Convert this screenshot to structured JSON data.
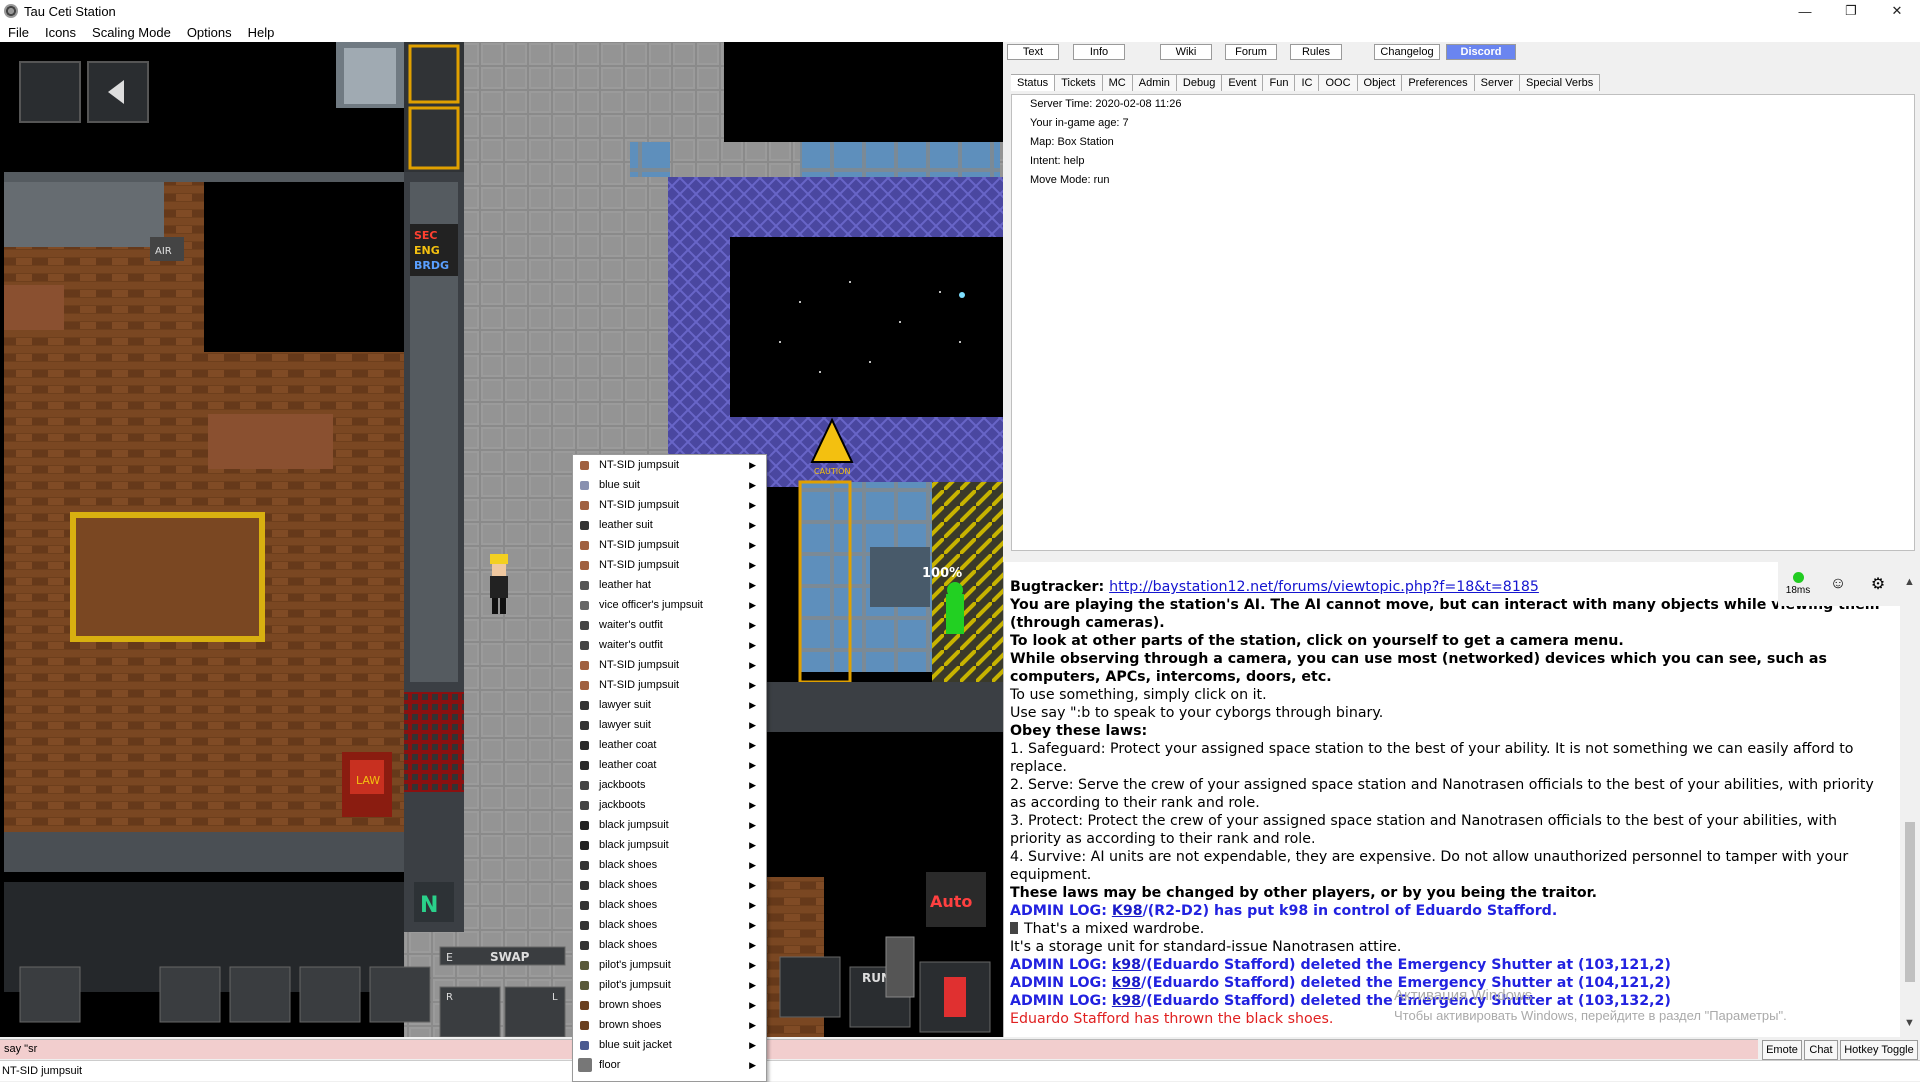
{
  "window": {
    "title": "Tau Ceti Station",
    "controls": [
      "—",
      "❐",
      "✕"
    ]
  },
  "menu": [
    "File",
    "Icons",
    "Scaling Mode",
    "Options",
    "Help"
  ],
  "links": [
    {
      "label": "Text"
    },
    {
      "label": "Info"
    },
    {
      "label": "Wiki"
    },
    {
      "label": "Forum"
    },
    {
      "label": "Rules"
    },
    {
      "label": "Changelog"
    },
    {
      "label": "Discord"
    }
  ],
  "tabs": [
    "Status",
    "Tickets",
    "MC",
    "Admin",
    "Debug",
    "Event",
    "Fun",
    "IC",
    "OOC",
    "Object",
    "Preferences",
    "Server",
    "Special Verbs"
  ],
  "status": [
    "Server Time: 2020-02-08 11:26",
    "Your in-game age: 7",
    "Map: Box Station",
    "Intent: help",
    "Move Mode: run"
  ],
  "hud": {
    "swap": "SWAP",
    "run": "RUN",
    "sec": "SEC",
    "eng": "ENG",
    "brdg": "BRDG",
    "air": "AIR",
    "percent": "100%",
    "auto": "Auto",
    "caution": "CAUTION",
    "e": "E",
    "r": "R",
    "l": "L",
    "n": "N",
    "law": "LAW"
  },
  "context_menu": [
    "NT-SID jumpsuit",
    "blue suit",
    "NT-SID jumpsuit",
    "leather suit",
    "NT-SID jumpsuit",
    "NT-SID jumpsuit",
    "leather hat",
    "vice officer's jumpsuit",
    "waiter's outfit",
    "waiter's outfit",
    "NT-SID jumpsuit",
    "NT-SID jumpsuit",
    "lawyer suit",
    "lawyer suit",
    "leather coat",
    "leather coat",
    "jackboots",
    "jackboots",
    "black jumpsuit",
    "black jumpsuit",
    "black shoes",
    "black shoes",
    "black shoes",
    "black shoes",
    "black shoes",
    "pilot's jumpsuit",
    "pilot's jumpsuit",
    "brown shoes",
    "brown shoes",
    "blue suit jacket",
    "floor"
  ],
  "chat": {
    "bugtracker_label": "Bugtracker:",
    "bugtracker_url": "http://baystation12.net/forums/viewtopic.php?f=18&t=8185",
    "intro1": "You are playing the station's AI. The AI cannot move, but can interact with many objects while viewing them (through cameras).",
    "intro2": "To look at other parts of the station, click on yourself to get a camera menu.",
    "intro3": "While observing through a camera, you can use most (networked) devices which you can see, such as computers, APCs, intercoms, doors, etc.",
    "intro4": "To use something, simply click on it.",
    "intro5": "Use say \":b to speak to your cyborgs through binary.",
    "laws_header": "Obey these laws:",
    "law1": "1. Safeguard: Protect your assigned space station to the best of your ability. It is not something we can easily afford to replace.",
    "law2": "2. Serve: Serve the crew of your assigned space station and Nanotrasen officials to the best of your abilities, with priority as according to their rank and role.",
    "law3": "3. Protect: Protect the crew of your assigned space station and Nanotrasen officials to the best of your abilities, with priority as according to their rank and role.",
    "law4": "4. Survive: AI units are not expendable, they are expensive. Do not allow unauthorized personnel to tamper with your equipment.",
    "laws_footer": "These laws may be changed by other players, or by you being the traitor.",
    "admin1_prefix": "ADMIN LOG:",
    "admin1_user": "K98",
    "admin1_text": "/(R2-D2) has put k98 in control of Eduardo Stafford.",
    "wardrobe": "That's a mixed wardrobe.",
    "storage": "It's a storage unit for standard-issue Nanotrasen attire.",
    "admin2_user": "k98",
    "admin2_text": "/(Eduardo Stafford) deleted the Emergency Shutter at (103,121,2)",
    "admin3_user": "k98",
    "admin3_text": "/(Eduardo Stafford) deleted the Emergency Shutter at (104,121,2)",
    "admin4_user": "k98",
    "admin4_text": "/(Eduardo Stafford) deleted the Emergency Shutter at (103,132,2)",
    "thrown": "Eduardo Stafford has thrown the black shoes.",
    "watermark1": "Активация Windows",
    "watermark2": "Чтобы активировать Windows, перейдите в раздел \"Параметры\"."
  },
  "ping": "18ms",
  "input": {
    "value": "say \"sr"
  },
  "bottom_buttons": [
    "Emote",
    "Chat",
    "Hotkey Toggle"
  ],
  "statusline": "NT-SID jumpsuit",
  "colors": {
    "discord": "#6a85f0",
    "admin_log": "#2222e0",
    "input_bg": "#f2cece",
    "thrown": "#e02020"
  }
}
